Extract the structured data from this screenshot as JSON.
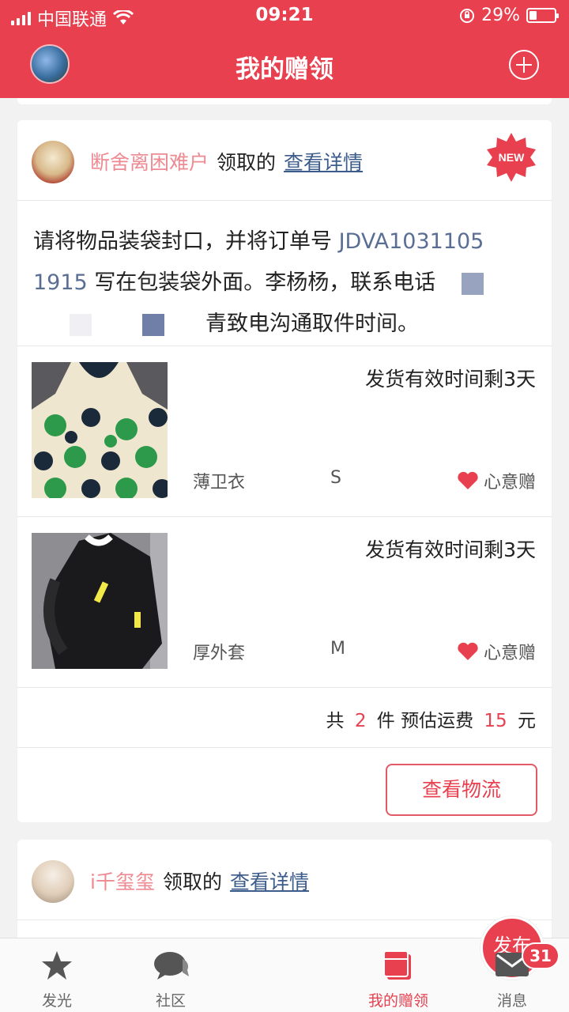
{
  "status_bar": {
    "carrier": "中国联通",
    "time": "09:21",
    "battery_percent": "29%",
    "battery_level": 0.29
  },
  "header": {
    "title": "我的赠领"
  },
  "orders": [
    {
      "user_name": "断舍离困难户",
      "claimed_text": "领取的",
      "detail_link": "查看详情",
      "badge": "NEW",
      "note_part1": "请将物品装袋封口，并将订单号",
      "order_number": "JDVA10311051915",
      "order_number_line1": "JDVA1031105",
      "order_number_line2": "1915",
      "note_part2": "写在包装袋外面。李杨杨，联系电话",
      "note_part3": "青致电沟通取件时间。",
      "items": [
        {
          "deadline": "发货有效时间剩3天",
          "name": "薄卫衣",
          "size": "S",
          "gift_type": "心意赠"
        },
        {
          "deadline": "发货有效时间剩3天",
          "name": "厚外套",
          "size": "M",
          "gift_type": "心意赠"
        }
      ],
      "summary": {
        "prefix": "共",
        "count": "2",
        "count_unit": "件",
        "shipping_label": "预估运费",
        "shipping_fee": "15",
        "currency": "元"
      },
      "logistics_button": "查看物流"
    },
    {
      "user_name": "i千玺玺",
      "claimed_text": "领取的",
      "detail_link": "查看详情"
    }
  ],
  "tabbar": {
    "tabs": [
      {
        "label": "发光",
        "icon": "star-icon"
      },
      {
        "label": "社区",
        "icon": "chat-bubble-icon"
      },
      {
        "label": "发布",
        "icon": "publish-icon"
      },
      {
        "label": "我的赠领",
        "icon": "gift-box-icon"
      },
      {
        "label": "消息",
        "icon": "envelope-icon"
      }
    ],
    "message_badge": "31"
  },
  "colors": {
    "brand": "#e8404f",
    "link": "#3c5c8c",
    "username": "#ee8a92"
  }
}
